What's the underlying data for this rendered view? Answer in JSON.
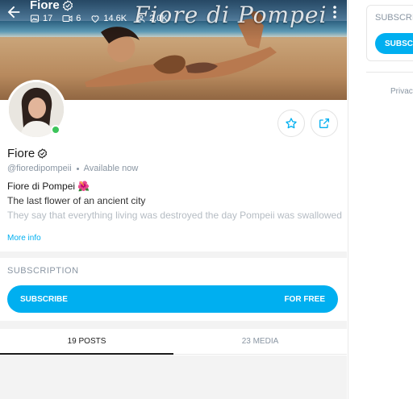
{
  "profile": {
    "name": "Fiore",
    "handle": "@fioredipompeii",
    "status": "Available now",
    "bio_title": "Fiore di Pompei 🌺",
    "bio_line": "The last flower of an ancient city",
    "bio_faded": "They say that everything living was destroyed the day Pompeii was swallowed",
    "more_info": "More info",
    "banner_watermark": "Fiore di Pompei"
  },
  "stats": {
    "photos": "17",
    "videos": "6",
    "likes": "14.6K",
    "fans": "2.0K"
  },
  "subscription": {
    "title": "SUBSCRIPTION",
    "button_left": "SUBSCRIBE",
    "button_right": "FOR FREE"
  },
  "tabs": [
    {
      "label": "19 POSTS",
      "active": true
    },
    {
      "label": "23 MEDIA",
      "active": false
    }
  ],
  "sidebar": {
    "title": "SUBSCRI",
    "button": "SUBSCR",
    "privacy": "Privacy"
  },
  "colors": {
    "accent": "#00aff0",
    "online": "#3cc45a",
    "muted": "#8a96a3"
  },
  "icons": [
    "back-arrow-icon",
    "verified-icon",
    "image-icon",
    "video-icon",
    "heart-icon",
    "fans-icon",
    "more-vertical-icon",
    "star-icon",
    "share-icon"
  ]
}
